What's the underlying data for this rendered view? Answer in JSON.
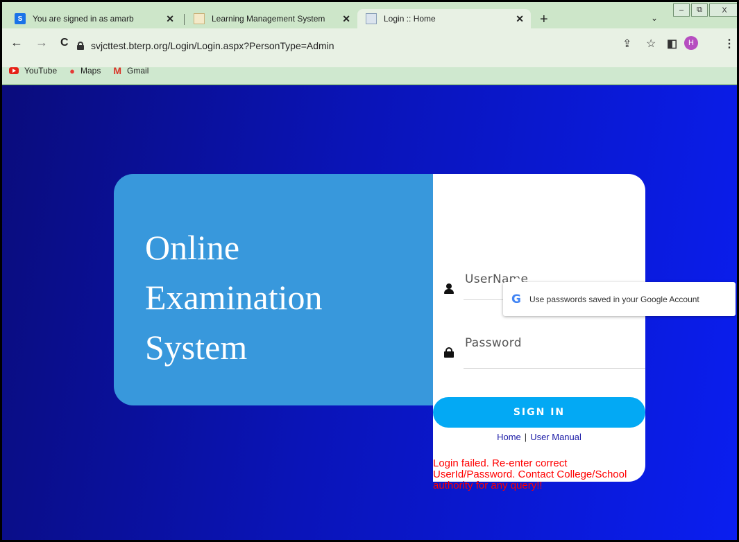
{
  "browser": {
    "tabs": [
      {
        "title": "You are signed in as amarb",
        "icon": "S",
        "close": "✕"
      },
      {
        "title": "Learning Management System",
        "icon": "lms",
        "close": "✕"
      },
      {
        "title": "Login :: Home",
        "icon": "doc",
        "close": "✕"
      }
    ],
    "new_tab": "+",
    "tab_search": "⌄",
    "window_controls": {
      "minimize": "–",
      "restore": "⧉",
      "close": "X"
    },
    "back": "←",
    "forward": "→",
    "reload": "C",
    "url": "svjcttest.bterp.org/Login/Login.aspx?PersonType=Admin",
    "share_icon": "⇪",
    "star_icon": "☆",
    "sidepanel_icon": "◧",
    "avatar_letter": "H",
    "menu_icon": "⋮",
    "bookmarks": [
      {
        "label": "YouTube",
        "icon": "youtube-icon"
      },
      {
        "label": "Maps",
        "icon": "maps-icon"
      },
      {
        "label": "Gmail",
        "icon": "gmail-icon"
      }
    ]
  },
  "hero": {
    "title_lines": [
      "Online",
      "Examination",
      "System"
    ]
  },
  "login": {
    "username_label": "UserName",
    "password_label": "Password",
    "signin_label": "SIGN IN",
    "home_link": "Home",
    "separator": "|",
    "manual_link": "User Manual",
    "error": "Login failed. Re-enter correct UserId/Password. Contact College/School authority for any query!!"
  },
  "password_popup": {
    "google_letter": "G",
    "text": "Use passwords saved in your Google Account"
  },
  "colors": {
    "hero": "#3898dc",
    "signin": "#03a9f4",
    "error": "#ff0000",
    "page_bg": "#0a14b8"
  }
}
